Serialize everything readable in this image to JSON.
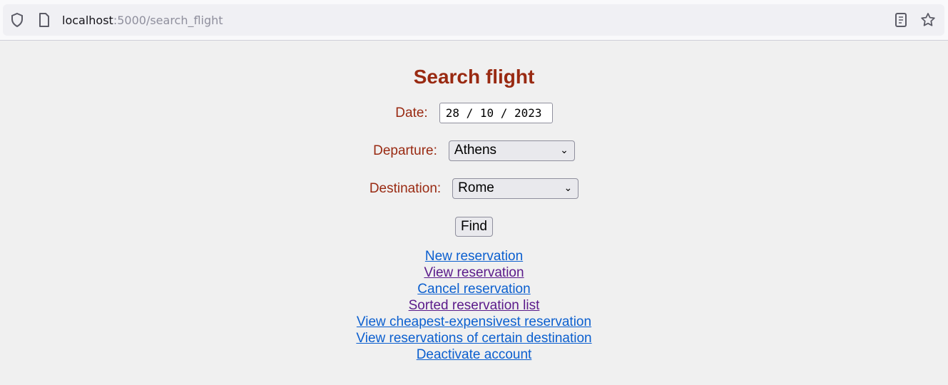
{
  "browser": {
    "url_host": "localhost",
    "url_rest": ":5000/search_flight"
  },
  "page": {
    "title": "Search flight",
    "date": {
      "label": "Date:",
      "value": "28 / 10 / 2023"
    },
    "departure": {
      "label": "Departure:",
      "value": "Athens"
    },
    "destination": {
      "label": "Destination:",
      "value": "Rome"
    },
    "find_label": "Find",
    "links": [
      {
        "label": "New reservation",
        "visited": false
      },
      {
        "label": "View reservation",
        "visited": true
      },
      {
        "label": "Cancel reservation",
        "visited": false
      },
      {
        "label": "Sorted reservation list",
        "visited": true
      },
      {
        "label": "View cheapest-expensivest reservation",
        "visited": false
      },
      {
        "label": "View reservations of certain destination",
        "visited": false
      },
      {
        "label": "Deactivate account",
        "visited": false
      }
    ]
  },
  "colors": {
    "heading": "#992a12",
    "link": "#0b5fcf",
    "visited": "#5a1a8a"
  }
}
